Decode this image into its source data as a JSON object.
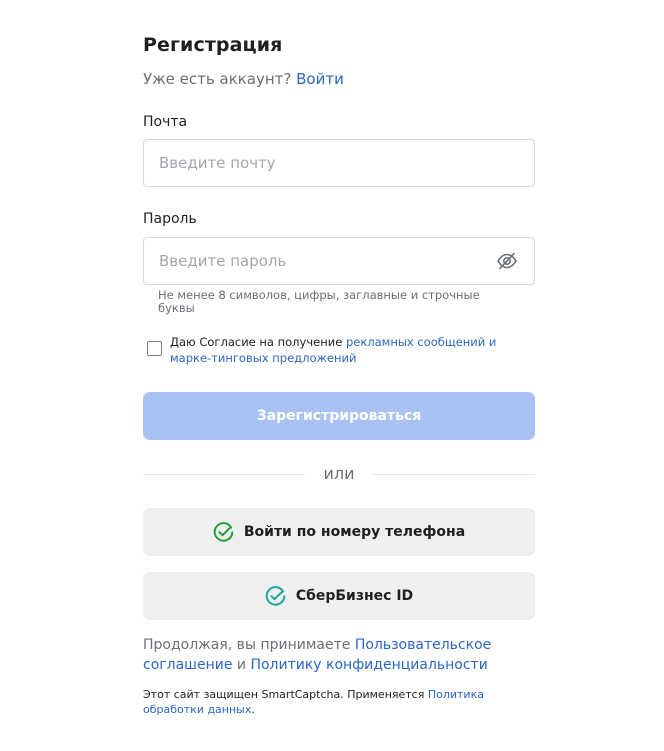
{
  "registration": {
    "title": "Регистрация",
    "have_account_text": "Уже есть аккаунт?",
    "login_link": "Войти"
  },
  "email": {
    "label": "Почта",
    "placeholder": "Введите почту",
    "value": ""
  },
  "password": {
    "label": "Пароль",
    "placeholder": "Введите пароль",
    "value": "",
    "visibility_icon": "eye-off-icon",
    "hint": "Не менее 8 символов, цифры, заглавные и строчные буквы"
  },
  "consent": {
    "checked": false,
    "text_prefix": "Даю Согласие на получение",
    "link_text": "рекламных сообщений и марке-тинговых предложений"
  },
  "register_button": {
    "label": "Зарегистрироваться",
    "color": "#a9c2f3"
  },
  "divider": {
    "text": "или"
  },
  "phone_login_button": {
    "label": "Войти по номеру телефона",
    "icon": "sber-check-icon",
    "icon_color": "#21a038"
  },
  "sber_business_button": {
    "label": "СберБизнес ID",
    "icon": "sber-check-icon",
    "icon_color": "#1fa69a"
  },
  "terms": {
    "prefix": "Продолжая, вы принимаете",
    "user_agreement_link": "Пользовательское соглашение",
    "and": "и",
    "privacy_link": "Политику конфиденциальности"
  },
  "captcha": {
    "text": "Этот сайт защищен SmartCaptcha. Применяется",
    "policy_link": "Политика обработки данных",
    "suffix": "."
  },
  "colors": {
    "link": "#2a66c4",
    "muted_text": "#6b6e75",
    "secondary_button_bg": "#efeff0"
  }
}
